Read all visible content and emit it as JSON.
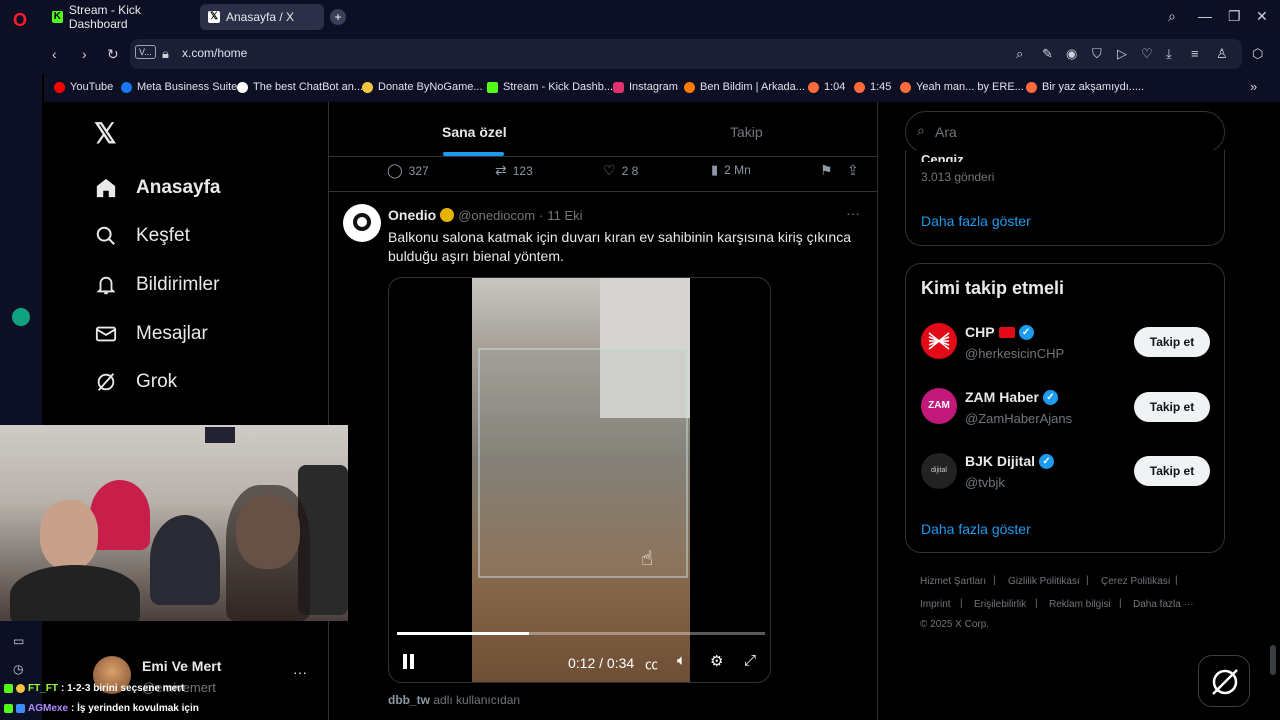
{
  "browser": {
    "tabs": [
      {
        "label": "Stream - Kick Dashboard",
        "active": false
      },
      {
        "label": "Anasayfa / X",
        "active": true
      }
    ],
    "url": "x.com/home",
    "vpn_label": "V...",
    "bookmarks": [
      {
        "label": "YouTube",
        "color": "#ff0000"
      },
      {
        "label": "Meta Business Suite",
        "color": "#1877f2"
      },
      {
        "label": "The best ChatBot an...",
        "color": "#ffffff"
      },
      {
        "label": "Donate ByNoGame...",
        "color": "#f5c542"
      },
      {
        "label": "Stream - Kick Dashb...",
        "color": "#53fc18"
      },
      {
        "label": "Instagram",
        "color": "#e1306c"
      },
      {
        "label": "Ben Bildim | Arkada...",
        "color": "#ff7a00"
      },
      {
        "label": "1:04",
        "color": "#ff6a3d"
      },
      {
        "label": "1:45",
        "color": "#ff6a3d"
      },
      {
        "label": "Yeah man... by ERE...",
        "color": "#ff6a3d"
      },
      {
        "label": "Bir yaz akşamıydı.....",
        "color": "#ff6a3d"
      }
    ]
  },
  "nav": {
    "items": [
      {
        "label": "Anasayfa",
        "icon": "home-icon"
      },
      {
        "label": "Keşfet",
        "icon": "search-icon"
      },
      {
        "label": "Bildirimler",
        "icon": "bell-icon"
      },
      {
        "label": "Mesajlar",
        "icon": "mail-icon"
      },
      {
        "label": "Grok",
        "icon": "grok-icon"
      }
    ],
    "account": {
      "name": "Emi Ve Mert",
      "handle": "@emivemert"
    }
  },
  "timeline": {
    "tabs": [
      "Sana özel",
      "Takip"
    ],
    "prev_actions": {
      "replies": "327",
      "reposts": "123",
      "likes": "2 8",
      "views": "2 Mn"
    },
    "tweet": {
      "author": "Onedio",
      "handle": "@onediocom",
      "date": "11 Eki",
      "separator": "·",
      "text": "Balkonu salona katmak için duvarı kıran ev sahibinin karşısına kiriş çıkınca bulduğu aşırı bienal yöntem.",
      "video_time": "0:12 / 0:34",
      "video_progress": 0.36,
      "attribution_user": "dbb_tw",
      "attribution_suffix": "adlı kullanıcıdan"
    }
  },
  "right": {
    "search_placeholder": "Ara",
    "trend_partial": {
      "name": "Cengiz",
      "posts": "3.013 gönderi"
    },
    "show_more": "Daha fazla göster",
    "who_to_follow_title": "Kimi takip etmeli",
    "follow_label": "Takip et",
    "accounts": [
      {
        "name": "CHP",
        "handle": "@herkesicinCHP",
        "avatar_color": "#e30a17",
        "avatar_text": ""
      },
      {
        "name": "ZAM Haber",
        "handle": "@ZamHaberAjans",
        "avatar_color": "#c2187a",
        "avatar_text": "ZAM"
      },
      {
        "name": "BJK Dijital",
        "handle": "@tvbjk",
        "avatar_color": "#222222",
        "avatar_text": "dijital"
      }
    ],
    "footer_row1": [
      "Hizmet Şartları",
      "Gizlilik Politikası",
      "Çerez Politikası"
    ],
    "footer_row2": [
      "Imprint",
      "Erişilebilirlik",
      "Reklam bilgisi",
      "Daha fazla ···"
    ],
    "copyright": "© 2025 X Corp."
  },
  "chat": [
    {
      "user": "FT_FT",
      "msg": ": 1-2-3 birini seçsene mert"
    },
    {
      "user": "AGMexe",
      "msg": ": İş yerinden kovulmak için"
    }
  ]
}
